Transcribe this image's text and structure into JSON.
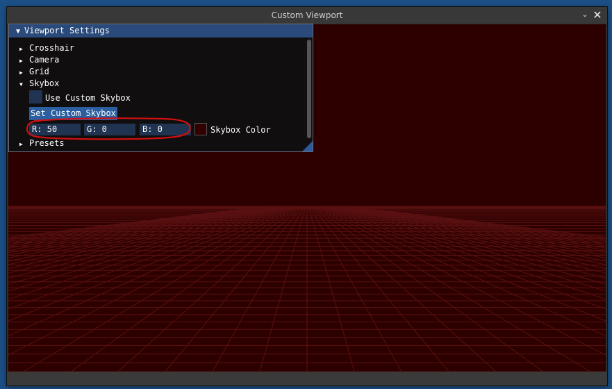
{
  "window": {
    "title": "Custom Viewport",
    "icons": {
      "chevron": "chevron-down-icon",
      "close": "close-icon"
    },
    "glyphs": {
      "chevron": "⌄",
      "close": "✕"
    }
  },
  "colors": {
    "desktop": "#1c4f86",
    "viewport_bg": "#2d0000",
    "grid_line": "#5a1010",
    "panel_title": "#294a7a",
    "button": "#2b5fa0",
    "frame_bg": "#203350",
    "annotation": "#d01010"
  },
  "panel": {
    "title": "Viewport Settings",
    "title_arrow": "▼",
    "items": [
      {
        "label": "Crosshair",
        "arrow": "▶"
      },
      {
        "label": "Camera",
        "arrow": "▶"
      },
      {
        "label": "Grid",
        "arrow": "▶"
      },
      {
        "label": "Skybox",
        "arrow": "▼"
      },
      {
        "label": "Presets",
        "arrow": "▶"
      }
    ],
    "skybox": {
      "use_custom_label": "Use Custom Skybox",
      "use_custom_checked": false,
      "set_button_label": "Set Custom Skybox",
      "r_field": "R: 50",
      "g_field": "G: 0",
      "b_field": "B: 0",
      "color_label": "Skybox Color",
      "color_value": "#320000"
    }
  }
}
